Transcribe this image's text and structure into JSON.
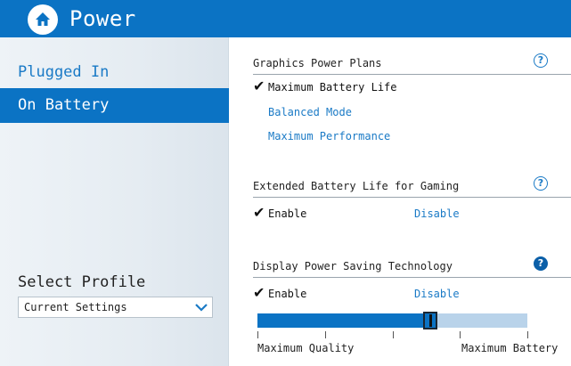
{
  "window": {
    "title": "Power"
  },
  "sidebar": {
    "items": [
      {
        "label": "Plugged In",
        "active": false
      },
      {
        "label": "On Battery",
        "active": true
      }
    ],
    "profile": {
      "label": "Select Profile",
      "selected": "Current Settings"
    }
  },
  "sections": {
    "graphics": {
      "header": "Graphics Power Plans",
      "options": [
        {
          "label": "Maximum Battery Life",
          "selected": true
        },
        {
          "label": "Balanced Mode",
          "selected": false
        },
        {
          "label": "Maximum Performance",
          "selected": false
        }
      ]
    },
    "gaming": {
      "header": "Extended Battery Life for Gaming",
      "enable": "Enable",
      "disable": "Disable",
      "enabled": true
    },
    "display": {
      "header": "Display Power Saving Technology",
      "enable": "Enable",
      "disable": "Disable",
      "enabled": true,
      "slider": {
        "min_label": "Maximum Quality",
        "max_label": "Maximum Battery",
        "level": 0.64,
        "ticks": 5
      }
    }
  },
  "icons": {
    "home": "home-icon",
    "help": "help-icon",
    "check": "check-icon",
    "dropdown": "chevron-down-icon"
  },
  "colors": {
    "accent": "#0b73c4",
    "link": "#1a7ac6",
    "sidebar_bg": "#e5ecf2"
  }
}
